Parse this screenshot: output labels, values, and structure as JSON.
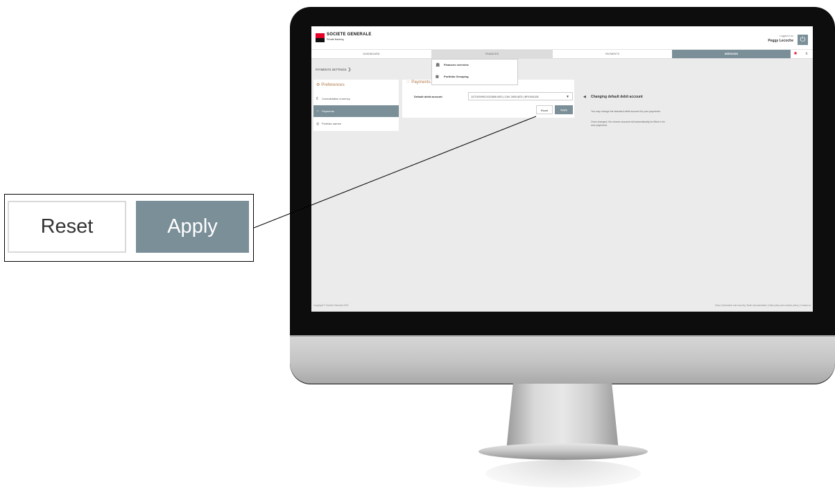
{
  "header": {
    "brand": "SOCIETE GENERALE",
    "brand_sub": "Private Banking",
    "login_label": "Logged in as",
    "user_name": "Peggy Lecoche"
  },
  "nav": {
    "tabs": [
      {
        "label": "DASHBOARD"
      },
      {
        "label": "FINANCES"
      },
      {
        "label": "PAYMENTS"
      },
      {
        "label": "SERVICES"
      }
    ],
    "more": "±"
  },
  "dropdown": {
    "items": [
      {
        "label": "Finances overview",
        "icon": "bank-icon"
      },
      {
        "label": "Portfolio Grouping",
        "icon": "grid-icon"
      }
    ]
  },
  "breadcrumb": {
    "label": "PAYMENTS SETTINGS"
  },
  "sidebar": {
    "title": "Preferences",
    "items": [
      {
        "label": "Consolidation currency",
        "icon": "currency-icon"
      },
      {
        "label": "Payments",
        "icon": "hand-icon",
        "active": true
      },
      {
        "label": "Portfolio names",
        "icon": "portfolio-icon"
      }
    ]
  },
  "payments": {
    "title": "Payments",
    "field_label": "Default debit account",
    "select_value": "1/27000/993-0022806 AED | CAV 2800 AED | BP1004128",
    "reset_label": "Reset",
    "apply_label": "Apply"
  },
  "help": {
    "title": "Changing default debit account",
    "paragraph_1": "You may change the standard debit account for your payments.",
    "paragraph_2": "Once changed, the chosen account will automatically be filled in for new payments."
  },
  "footer": {
    "copyright": "Copyright © Societe Generale 2020",
    "links": "Help  |  Information and security  |  Bank documentation  |  Data policy and cookies policy  |  Contact us"
  },
  "callout": {
    "reset_label": "Reset",
    "apply_label": "Apply"
  },
  "colors": {
    "accent": "#7b8f99",
    "brand_red": "#e60028",
    "heading_brown": "#b07a4a"
  }
}
